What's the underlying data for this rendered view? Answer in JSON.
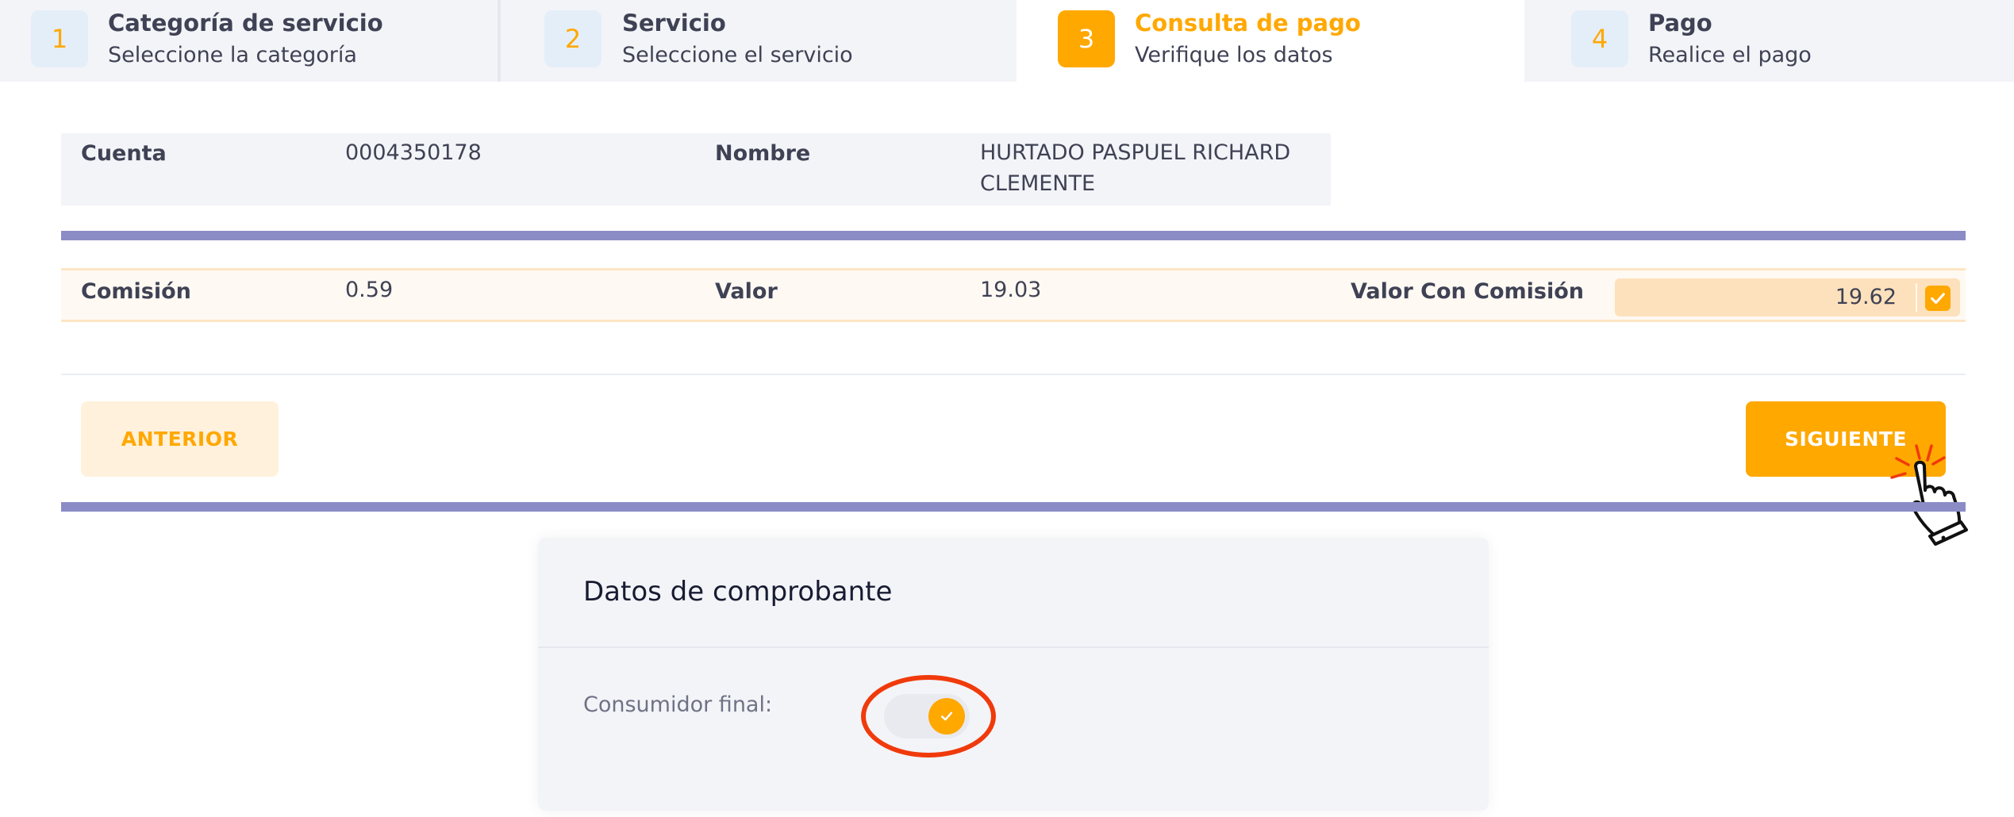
{
  "stepper": {
    "steps": [
      {
        "number": "1",
        "title": "Categoría de servicio",
        "subtitle": "Seleccione la categoría"
      },
      {
        "number": "2",
        "title": "Servicio",
        "subtitle": "Seleccione el servicio"
      },
      {
        "number": "3",
        "title": "Consulta de pago",
        "subtitle": "Verifique los datos"
      },
      {
        "number": "4",
        "title": "Pago",
        "subtitle": "Realice el pago"
      }
    ],
    "active_step": 3
  },
  "account": {
    "cuenta_label": "Cuenta",
    "cuenta_value": "0004350178",
    "nombre_label": "Nombre",
    "nombre_value": "HURTADO PASPUEL RICHARD CLEMENTE"
  },
  "payment": {
    "comision_label": "Comisión",
    "comision_value": "0.59",
    "valor_label": "Valor",
    "valor_value": "19.03",
    "total_label": "Valor Con Comisión",
    "total_value": "19.62",
    "total_checked": true
  },
  "buttons": {
    "prev_label": "ANTERIOR",
    "next_label": "SIGUIENTE"
  },
  "receipt": {
    "title": "Datos de comprobante",
    "consumer_label": "Consumidor final:",
    "consumer_final_enabled": true
  },
  "colors": {
    "accent": "#ffa800",
    "divider": "#8b8cc6",
    "highlight_circle": "#f03a0c"
  },
  "icons": {
    "check": "check-icon",
    "cursor": "hand-pointer-icon"
  }
}
